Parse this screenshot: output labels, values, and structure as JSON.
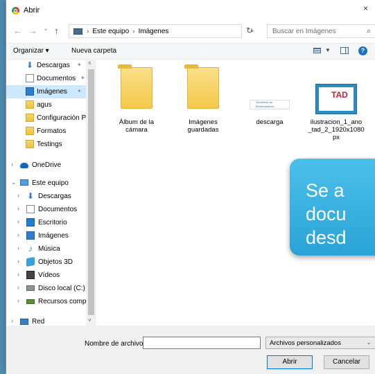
{
  "window": {
    "title": "Abrir",
    "close_glyph": "×"
  },
  "nav": {
    "back_glyph": "←",
    "forward_glyph": "→",
    "recent_glyph": "⌄",
    "up_glyph": "↑",
    "breadcrumbs": [
      "Este equipo",
      "Imágenes"
    ],
    "refresh_glyph": "↻",
    "search_placeholder": "Buscar en Imágenes",
    "search_glyph": "⌕"
  },
  "toolbar": {
    "organize_label": "Organizar ▾",
    "new_folder_label": "Nueva carpeta",
    "help_glyph": "?"
  },
  "sidebar": {
    "quick_access": [
      {
        "label": "Descargas",
        "icon": "download-icon",
        "pinned": true
      },
      {
        "label": "Documentos",
        "icon": "document-icon",
        "pinned": true
      },
      {
        "label": "Imágenes",
        "icon": "pictures-icon",
        "pinned": true,
        "selected": true
      },
      {
        "label": "agus",
        "icon": "folder-icon"
      },
      {
        "label": "Configuración P",
        "icon": "folder-icon"
      },
      {
        "label": "Formatos",
        "icon": "folder-icon"
      },
      {
        "label": "Testings",
        "icon": "folder-icon"
      }
    ],
    "onedrive": "OneDrive",
    "this_pc": "Este equipo",
    "this_pc_items": [
      {
        "label": "Descargas",
        "icon": "download-icon"
      },
      {
        "label": "Documentos",
        "icon": "document-icon"
      },
      {
        "label": "Escritorio",
        "icon": "desktop-icon"
      },
      {
        "label": "Imágenes",
        "icon": "pictures-icon"
      },
      {
        "label": "Música",
        "icon": "music-icon"
      },
      {
        "label": "Objetos 3D",
        "icon": "3d-objects-icon"
      },
      {
        "label": "Vídeos",
        "icon": "video-icon"
      },
      {
        "label": "Disco local (C:)",
        "icon": "disk-icon"
      },
      {
        "label": "Recursos compa",
        "icon": "shared-icon"
      }
    ],
    "network": "Red"
  },
  "files": [
    {
      "name": "Álbum de la\ncámara",
      "type": "folder"
    },
    {
      "name": "Imágenes\nguardadas",
      "type": "folder"
    },
    {
      "name": "descarga",
      "type": "image",
      "thumb_text": "Secretaría de Modernización\nPresidencia de la Nación"
    },
    {
      "name": "ilustracion_1_ano\n_tad_2_1920x1080\npx",
      "type": "image",
      "thumb_text": "TAD"
    }
  ],
  "footer": {
    "filename_label": "Nombre de archivo:",
    "filename_value": "",
    "filetype_value": "Archivos personalizados",
    "open_label": "Abrir",
    "cancel_label": "Cancelar"
  },
  "overlay": {
    "text": "Se a\ndocu\ndesd"
  },
  "colors": {
    "accent": "#0078d7",
    "selection": "#cce8ff",
    "slide": "#33acdf"
  }
}
